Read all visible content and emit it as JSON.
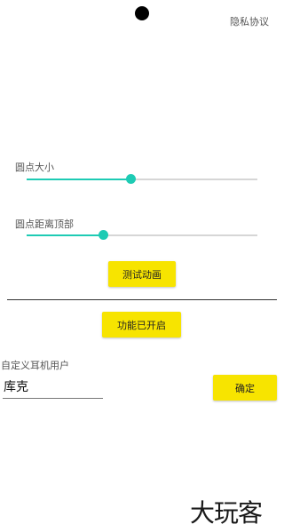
{
  "header": {
    "privacy_label": "隐私协议"
  },
  "settings": {
    "dot_size": {
      "label": "圆点大小",
      "value_percent": 45
    },
    "dot_top_distance": {
      "label": "圆点距离顶部",
      "value_percent": 33
    },
    "test_animation_label": "测试动画"
  },
  "feature": {
    "toggle_label": "功能已开启"
  },
  "custom_user": {
    "label": "自定义耳机用户",
    "input_value": "库克",
    "confirm_label": "确定"
  },
  "watermark": {
    "text": "大玩客"
  },
  "colors": {
    "accent": "#1ecbb4",
    "button": "#f7e400",
    "divider": "#333333"
  }
}
